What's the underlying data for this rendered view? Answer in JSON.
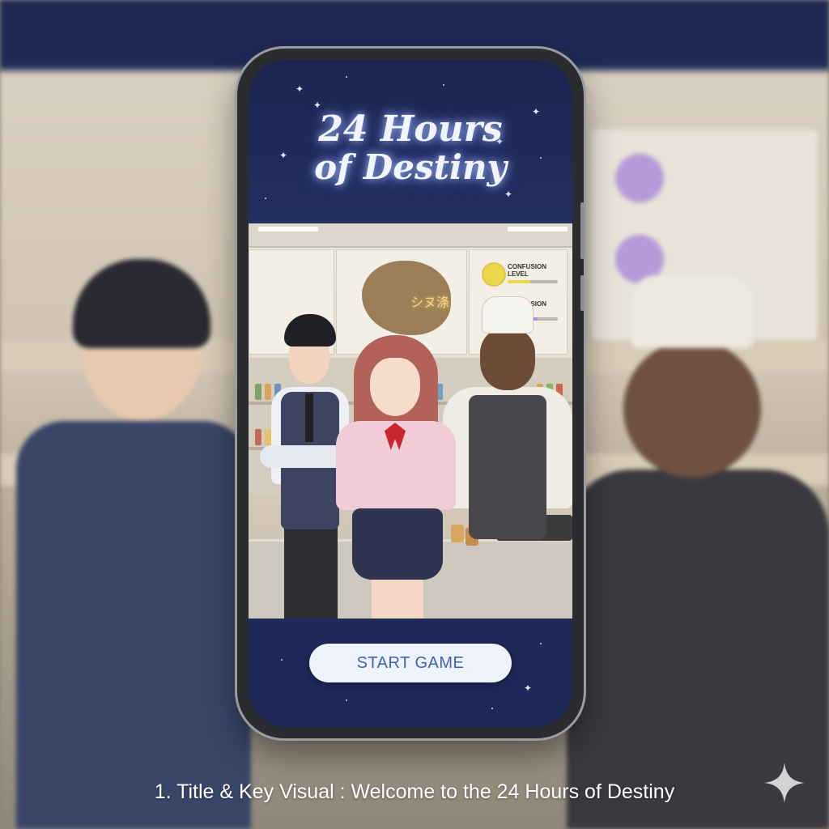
{
  "game": {
    "title_line1": "24 Hours",
    "title_line2": "of Destiny",
    "start_button": "START GAME"
  },
  "scene": {
    "stain_text": "シヌ涤",
    "meters": [
      {
        "label": "CONFUSION LEVEL",
        "color": "#e9d84a",
        "level": 0.45
      },
      {
        "label": "CONFUSION LEVEL",
        "color": "#b58be0",
        "level": 0.6
      }
    ]
  },
  "caption": "1. Title & Key Visual : Welcome to the 24 Hours of Destiny",
  "colors": {
    "night_sky": "#1c2550",
    "button_text": "#3f62b8",
    "button_bg": "#eef2fb"
  },
  "icons": {
    "corner": "sparkle-icon"
  }
}
